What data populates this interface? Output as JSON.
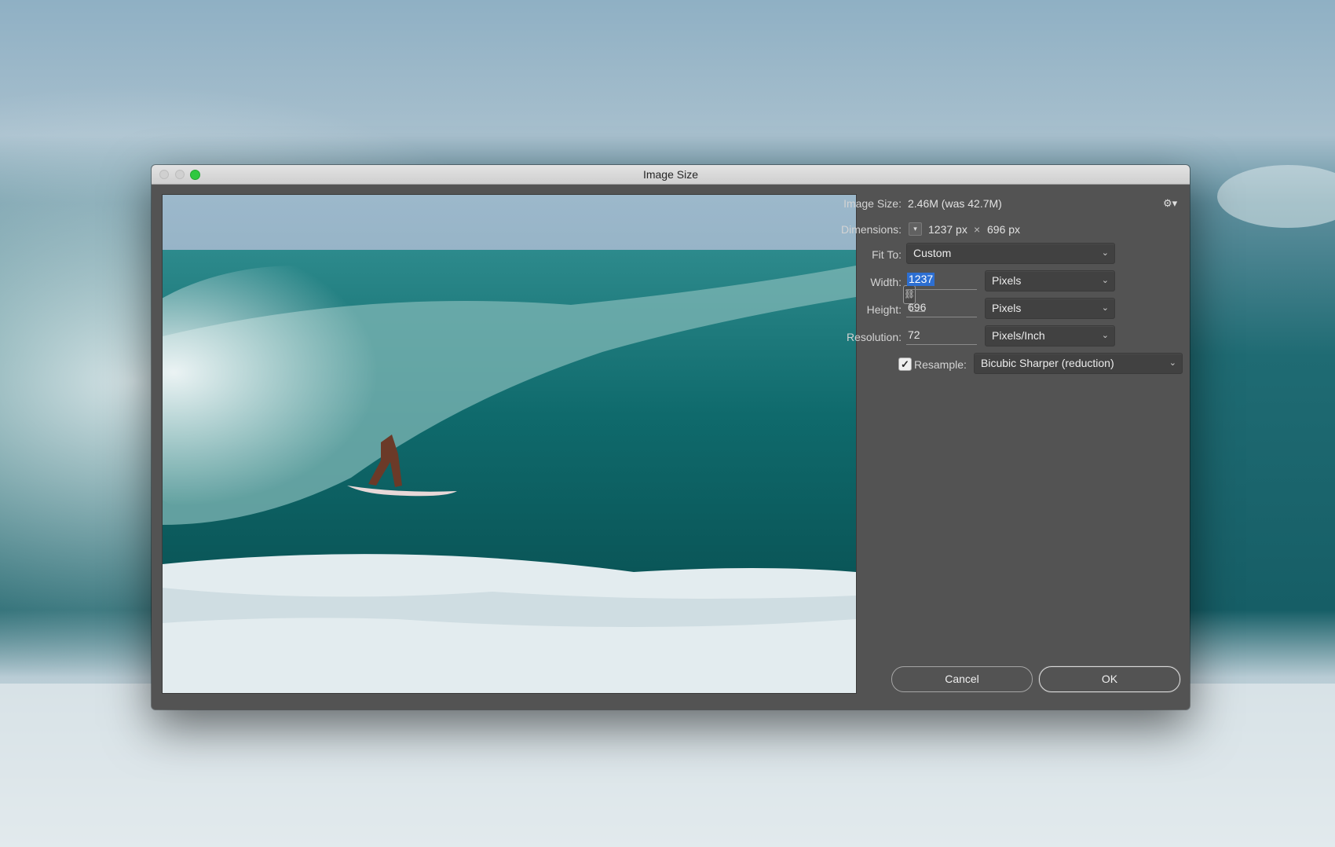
{
  "window": {
    "title": "Image Size"
  },
  "panel": {
    "image_size_label": "Image Size:",
    "image_size_value": "2.46M (was 42.7M)",
    "dimensions_label": "Dimensions:",
    "dimensions_width": "1237 px",
    "dimensions_sep": "×",
    "dimensions_height": "696 px",
    "fit_to_label": "Fit To:",
    "fit_to_value": "Custom",
    "width_label": "Width:",
    "width_value": "1237",
    "width_unit": "Pixels",
    "height_label": "Height:",
    "height_value": "696",
    "height_unit": "Pixels",
    "resolution_label": "Resolution:",
    "resolution_value": "72",
    "resolution_unit": "Pixels/Inch",
    "resample_label": "Resample:",
    "resample_checked": true,
    "resample_value": "Bicubic Sharper (reduction)"
  },
  "buttons": {
    "cancel": "Cancel",
    "ok": "OK"
  },
  "icons": {
    "gear": "gear-icon",
    "chain": "chain-link-icon",
    "chevron": "chevron-down-icon",
    "check": "checkmark-icon"
  },
  "colors": {
    "dialog_bg": "#535353",
    "selection": "#2d6fd2",
    "zoom_button": "#2fc840",
    "ocean_teal": "#1b6a6f"
  }
}
